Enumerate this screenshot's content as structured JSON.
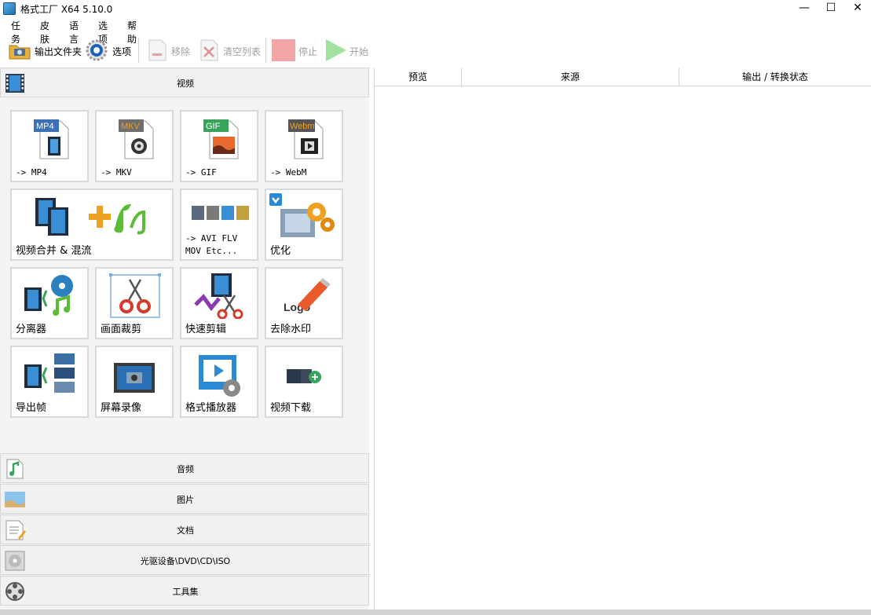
{
  "window": {
    "title": "格式工厂 X64 5.10.0",
    "min": "—",
    "max": "☐",
    "close": "✕"
  },
  "menu": [
    "任务",
    "皮肤",
    "语言",
    "选项",
    "帮助"
  ],
  "toolbar": {
    "output_folder": "输出文件夹",
    "options": "选项",
    "remove": "移除",
    "clear_list": "清空列表",
    "stop": "停止",
    "start": "开始"
  },
  "categories": {
    "video": "视频",
    "audio": "音频",
    "image": "图片",
    "document": "文档",
    "disc": "光驱设备\\DVD\\CD\\ISO",
    "tools": "工具集"
  },
  "tiles": {
    "mp4": {
      "label": "-> MP4",
      "badge": "MP4"
    },
    "mkv": {
      "label": "-> MKV",
      "badge": "MKV"
    },
    "gif": {
      "label": "-> GIF",
      "badge": "GIF"
    },
    "webm": {
      "label": "-> WebM",
      "badge": "Webm"
    },
    "merge": {
      "label": "视频合并 & 混流"
    },
    "avi": {
      "label": "-> AVI FLV\nMOV Etc..."
    },
    "optimize": {
      "label": "优化"
    },
    "splitter": {
      "label": "分离器"
    },
    "crop": {
      "label": "画面裁剪"
    },
    "quick_cut": {
      "label": "快速剪辑"
    },
    "watermark": {
      "label": "去除水印",
      "logo_text": "Logo"
    },
    "export_frames": {
      "label": "导出帧"
    },
    "screen_record": {
      "label": "屏幕录像"
    },
    "player": {
      "label": "格式播放器"
    },
    "download": {
      "label": "视频下载"
    }
  },
  "table": {
    "columns": [
      "预览",
      "来源",
      "输出 / 转换状态"
    ]
  },
  "colors": {
    "mp4": "#3b6fb6",
    "mkv": "#6e6e6e",
    "gif": "#3aa35a",
    "webm": "#555555",
    "webm_text": "#f0a020"
  }
}
